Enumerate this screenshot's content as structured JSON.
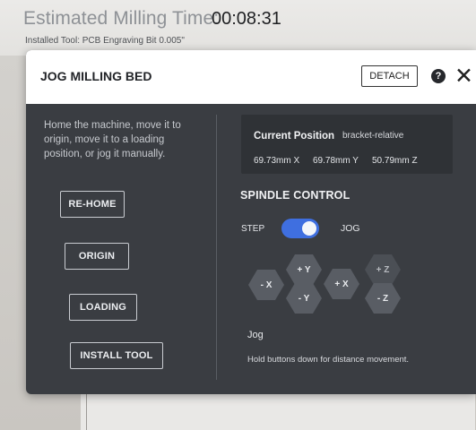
{
  "app": {
    "estimated_label": "Estimated Milling Time:",
    "estimated_value": "00:08:31",
    "installed_tool": "Installed Tool: PCB Engraving Bit 0.005\""
  },
  "modal": {
    "title": "JOG MILLING BED",
    "detach_label": "DETACH",
    "help_symbol": "?",
    "close_symbol": "✕",
    "intro": "Home the machine, move it to origin, move it to a loading position, or jog it manually.",
    "buttons": {
      "rehome": "RE-HOME",
      "origin": "ORIGIN",
      "loading": "LOADING",
      "install_tool": "INSTALL TOOL"
    },
    "position": {
      "title": "Current Position",
      "mode": "bracket-relative",
      "x": "69.73mm X",
      "y": "69.78mm Y",
      "z": "50.79mm Z"
    },
    "spindle": {
      "title": "SPINDLE CONTROL",
      "step_label": "STEP",
      "jog_label": "JOG",
      "toggle_state": "jog"
    },
    "jogpad": {
      "minus_x": "- X",
      "plus_y": "+ Y",
      "minus_y": "- Y",
      "plus_x": "+ X",
      "plus_z": "+ Z",
      "minus_z": "- Z"
    },
    "jog_section_label": "Jog",
    "jog_hint": "Hold buttons down for distance movement."
  },
  "colors": {
    "modal_bg": "#3a3d42",
    "toggle_accent": "#3f6fe0",
    "header_bg": "#ffffff"
  }
}
